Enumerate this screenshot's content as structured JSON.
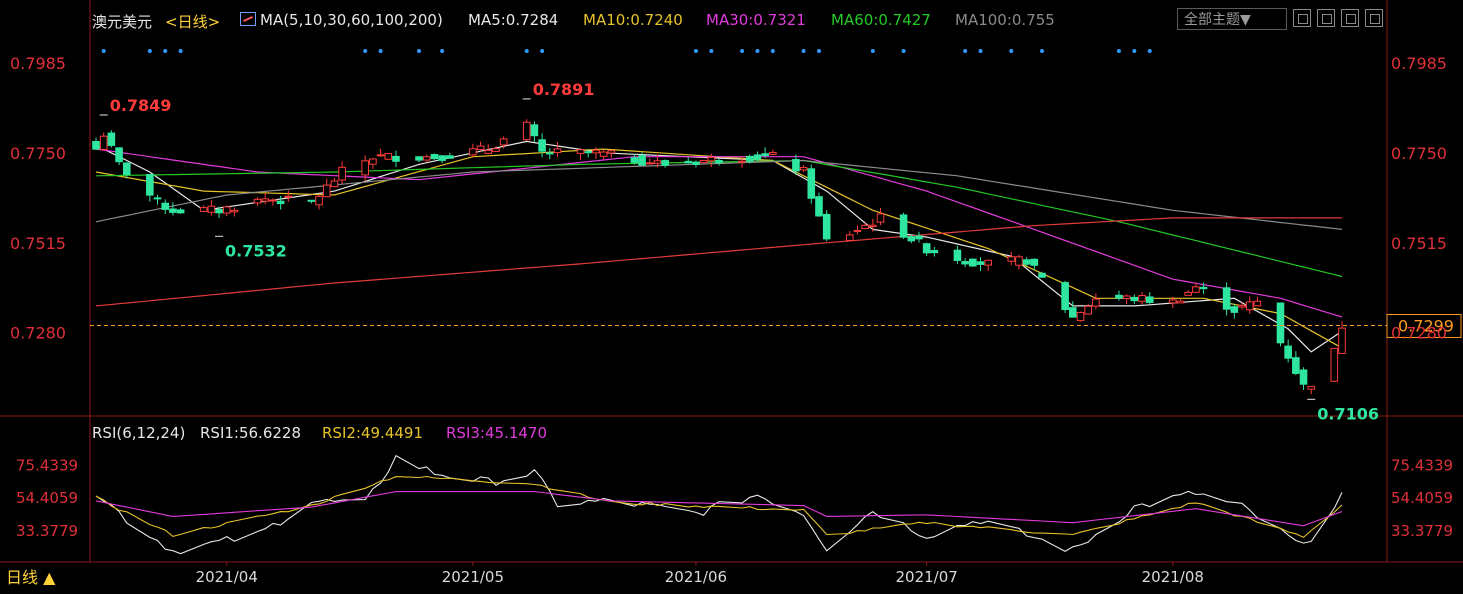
{
  "header": {
    "instrument": "澳元美元",
    "period_tag": "<日线>",
    "ma_label": "MA(5,10,30,60,100,200)",
    "ma5": "MA5:0.7284",
    "ma10": "MA10:0.7240",
    "ma30": "MA30:0.7321",
    "ma60": "MA60:0.7427",
    "ma100": "MA100:0.755",
    "theme_button": "全部主题▼"
  },
  "footer": {
    "period_button": "日线 ▲"
  },
  "colors": {
    "background": "#000000",
    "up": "#ff3b3b",
    "down": "#2ee6a0",
    "ma5": "#e8e8e8",
    "ma10": "#e6c229",
    "ma30": "#e23bdc",
    "ma60": "#25c925",
    "ma100": "#8a8a8a",
    "ma200": "#e03a3a",
    "axis_text": "#e0303a",
    "date_text": "#d9d9d9",
    "dots": "#2f9bff",
    "current_price": "#ff9b1f",
    "rsi1": "#e8e8e8",
    "rsi2": "#e6c229",
    "rsi3": "#e23bdc"
  },
  "chart_data": [
    {
      "type": "candlestick",
      "title": "澳元美元 日线",
      "y_ticks": [
        "0.7985",
        "0.7750",
        "0.7515",
        "0.7280"
      ],
      "ylim": [
        0.7065,
        0.8045
      ],
      "x_tick_labels": [
        "2021/04",
        "2021/05",
        "2021/06",
        "2021/07",
        "2021/08"
      ],
      "x_tick_dates": [
        "2021-04-01",
        "2021-05-03",
        "2021-06-01",
        "2021-07-01",
        "2021-08-02"
      ],
      "date_range": [
        "2021-03-15",
        "2021-08-24"
      ],
      "current_price": "0.7299",
      "annotations": [
        {
          "text": "0.7849",
          "date": "2021-03-16",
          "value": 0.7849,
          "kind": "high"
        },
        {
          "text": "0.7532",
          "date": "2021-03-31",
          "value": 0.7532,
          "kind": "low"
        },
        {
          "text": "0.7891",
          "date": "2021-05-10",
          "value": 0.7891,
          "kind": "high"
        },
        {
          "text": "0.7106",
          "date": "2021-08-20",
          "value": 0.7106,
          "kind": "low"
        }
      ],
      "moving_averages": [
        {
          "name": "MA5",
          "last": 0.7284
        },
        {
          "name": "MA10",
          "last": 0.724
        },
        {
          "name": "MA30",
          "last": 0.7321
        },
        {
          "name": "MA60",
          "last": 0.7427
        },
        {
          "name": "MA100",
          "last": 0.755
        }
      ],
      "anchor_points": [
        [
          "2021-03-15",
          0.776
        ],
        [
          "2021-03-16",
          0.78
        ],
        [
          "2021-03-18",
          0.772
        ],
        [
          "2021-03-23",
          0.762
        ],
        [
          "2021-03-25",
          0.76
        ],
        [
          "2021-03-31",
          0.76
        ],
        [
          "2021-04-06",
          0.763
        ],
        [
          "2021-04-12",
          0.762
        ],
        [
          "2021-04-16",
          0.77
        ],
        [
          "2021-04-20",
          0.774
        ],
        [
          "2021-04-28",
          0.774
        ],
        [
          "2021-05-05",
          0.776
        ],
        [
          "2021-05-10",
          0.782
        ],
        [
          "2021-05-12",
          0.775
        ],
        [
          "2021-05-19",
          0.775
        ],
        [
          "2021-05-28",
          0.772
        ],
        [
          "2021-06-07",
          0.774
        ],
        [
          "2021-06-11",
          0.774
        ],
        [
          "2021-06-15",
          0.77
        ],
        [
          "2021-06-18",
          0.752
        ],
        [
          "2021-06-21",
          0.754
        ],
        [
          "2021-06-25",
          0.758
        ],
        [
          "2021-07-01",
          0.75
        ],
        [
          "2021-07-06",
          0.747
        ],
        [
          "2021-07-09",
          0.746
        ],
        [
          "2021-07-14",
          0.747
        ],
        [
          "2021-07-20",
          0.732
        ],
        [
          "2021-07-23",
          0.737
        ],
        [
          "2021-07-28",
          0.737
        ],
        [
          "2021-08-02",
          0.736
        ],
        [
          "2021-08-05",
          0.74
        ],
        [
          "2021-08-10",
          0.734
        ],
        [
          "2021-08-13",
          0.736
        ],
        [
          "2021-08-17",
          0.722
        ],
        [
          "2021-08-19",
          0.714
        ],
        [
          "2021-08-20",
          0.715
        ],
        [
          "2021-08-23",
          0.723
        ],
        [
          "2021-08-24",
          0.73
        ]
      ],
      "ma_paths": {
        "MA5": [
          [
            "2021-03-15",
            0.777
          ],
          [
            "2021-03-22",
            0.77
          ],
          [
            "2021-03-29",
            0.76
          ],
          [
            "2021-04-15",
            0.765
          ],
          [
            "2021-04-26",
            0.772
          ],
          [
            "2021-05-10",
            0.778
          ],
          [
            "2021-05-20",
            0.775
          ],
          [
            "2021-06-11",
            0.773
          ],
          [
            "2021-06-18",
            0.765
          ],
          [
            "2021-06-24",
            0.755
          ],
          [
            "2021-07-01",
            0.753
          ],
          [
            "2021-07-12",
            0.748
          ],
          [
            "2021-07-20",
            0.735
          ],
          [
            "2021-07-28",
            0.735
          ],
          [
            "2021-08-10",
            0.737
          ],
          [
            "2021-08-17",
            0.729
          ],
          [
            "2021-08-20",
            0.723
          ],
          [
            "2021-08-24",
            0.7284
          ]
        ],
        "MA10": [
          [
            "2021-03-15",
            0.77
          ],
          [
            "2021-03-29",
            0.765
          ],
          [
            "2021-04-15",
            0.764
          ],
          [
            "2021-05-03",
            0.774
          ],
          [
            "2021-05-20",
            0.776
          ],
          [
            "2021-06-11",
            0.773
          ],
          [
            "2021-06-24",
            0.76
          ],
          [
            "2021-07-09",
            0.75
          ],
          [
            "2021-07-23",
            0.737
          ],
          [
            "2021-08-06",
            0.737
          ],
          [
            "2021-08-16",
            0.733
          ],
          [
            "2021-08-24",
            0.724
          ]
        ],
        "MA30": [
          [
            "2021-03-15",
            0.776
          ],
          [
            "2021-04-05",
            0.77
          ],
          [
            "2021-04-26",
            0.768
          ],
          [
            "2021-05-24",
            0.774
          ],
          [
            "2021-06-15",
            0.774
          ],
          [
            "2021-07-01",
            0.765
          ],
          [
            "2021-07-15",
            0.755
          ],
          [
            "2021-08-02",
            0.742
          ],
          [
            "2021-08-16",
            0.737
          ],
          [
            "2021-08-24",
            0.7321
          ]
        ],
        "MA60": [
          [
            "2021-03-15",
            0.769
          ],
          [
            "2021-04-15",
            0.77
          ],
          [
            "2021-05-17",
            0.772
          ],
          [
            "2021-06-15",
            0.773
          ],
          [
            "2021-07-05",
            0.766
          ],
          [
            "2021-07-26",
            0.757
          ],
          [
            "2021-08-24",
            0.7427
          ]
        ],
        "MA100": [
          [
            "2021-03-15",
            0.757
          ],
          [
            "2021-04-01",
            0.764
          ],
          [
            "2021-05-03",
            0.77
          ],
          [
            "2021-06-15",
            0.773
          ],
          [
            "2021-07-05",
            0.769
          ],
          [
            "2021-08-02",
            0.76
          ],
          [
            "2021-08-24",
            0.755
          ]
        ],
        "MA200": [
          [
            "2021-03-15",
            0.735
          ],
          [
            "2021-04-15",
            0.741
          ],
          [
            "2021-05-17",
            0.746
          ],
          [
            "2021-06-15",
            0.751
          ],
          [
            "2021-07-15",
            0.756
          ],
          [
            "2021-08-02",
            0.758
          ],
          [
            "2021-08-24",
            0.758
          ]
        ]
      }
    },
    {
      "type": "line",
      "title": "RSI(6,12,24)",
      "header_labels": {
        "name": "RSI(6,12,24)",
        "rsi1": "RSI1:56.6228",
        "rsi2": "RSI2:49.4491",
        "rsi3": "RSI3:45.1470"
      },
      "y_ticks": [
        "75.4339",
        "54.4059",
        "33.3779"
      ],
      "ylim": [
        14,
        86
      ],
      "series": [
        {
          "name": "RSI1",
          "last": 56.6228,
          "path": [
            [
              "2021-03-15",
              58
            ],
            [
              "2021-03-19",
              40
            ],
            [
              "2021-03-25",
              20
            ],
            [
              "2021-04-05",
              30
            ],
            [
              "2021-04-12",
              52
            ],
            [
              "2021-04-19",
              50
            ],
            [
              "2021-04-23",
              80
            ],
            [
              "2021-04-28",
              70
            ],
            [
              "2021-05-05",
              64
            ],
            [
              "2021-05-11",
              70
            ],
            [
              "2021-05-14",
              50
            ],
            [
              "2021-05-21",
              52
            ],
            [
              "2021-06-01",
              44
            ],
            [
              "2021-06-09",
              56
            ],
            [
              "2021-06-15",
              44
            ],
            [
              "2021-06-18",
              22
            ],
            [
              "2021-06-24",
              46
            ],
            [
              "2021-07-01",
              30
            ],
            [
              "2021-07-08",
              40
            ],
            [
              "2021-07-14",
              30
            ],
            [
              "2021-07-20",
              20
            ],
            [
              "2021-07-28",
              48
            ],
            [
              "2021-08-05",
              57
            ],
            [
              "2021-08-11",
              48
            ],
            [
              "2021-08-16",
              32
            ],
            [
              "2021-08-19",
              22
            ],
            [
              "2021-08-24",
              56.6228
            ]
          ]
        },
        {
          "name": "RSI2",
          "last": 49.4491,
          "path": [
            [
              "2021-03-15",
              54
            ],
            [
              "2021-03-25",
              30
            ],
            [
              "2021-04-12",
              49
            ],
            [
              "2021-04-23",
              68
            ],
            [
              "2021-05-11",
              63
            ],
            [
              "2021-05-21",
              51
            ],
            [
              "2021-06-15",
              46
            ],
            [
              "2021-06-18",
              30
            ],
            [
              "2021-07-01",
              38
            ],
            [
              "2021-07-20",
              30
            ],
            [
              "2021-08-05",
              51
            ],
            [
              "2021-08-19",
              29
            ],
            [
              "2021-08-24",
              49.4491
            ]
          ]
        },
        {
          "name": "RSI3",
          "last": 45.147,
          "path": [
            [
              "2021-03-15",
              52
            ],
            [
              "2021-03-25",
              42
            ],
            [
              "2021-04-12",
              48
            ],
            [
              "2021-04-23",
              58
            ],
            [
              "2021-05-11",
              58
            ],
            [
              "2021-05-21",
              52
            ],
            [
              "2021-06-15",
              49
            ],
            [
              "2021-06-18",
              42
            ],
            [
              "2021-07-01",
              43
            ],
            [
              "2021-07-20",
              38
            ],
            [
              "2021-08-05",
              47
            ],
            [
              "2021-08-19",
              36
            ],
            [
              "2021-08-24",
              45.147
            ]
          ]
        }
      ]
    }
  ]
}
